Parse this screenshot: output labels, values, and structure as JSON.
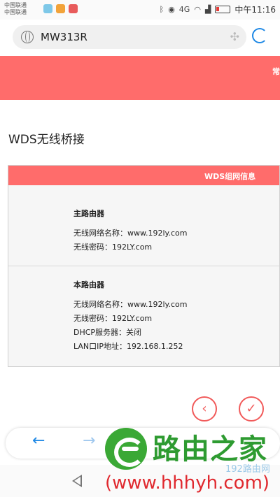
{
  "status_bar": {
    "carrier_1": "中国联通",
    "carrier_2": "中国联通",
    "network": "4G",
    "time": "中午11:16"
  },
  "address_bar": {
    "url": "MW313R"
  },
  "header": {
    "partial_text": "常"
  },
  "page": {
    "title": "WDS无线桥接"
  },
  "panel": {
    "title": "WDS组网信息",
    "main_router": {
      "heading": "主路由器",
      "ssid": "无线网络名称：www.192ly.com",
      "password": "无线密码：192LY.com"
    },
    "this_router": {
      "heading": "本路由器",
      "ssid": "无线网络名称：www.192ly.com",
      "password": "无线密码：192LY.com",
      "dhcp": "DHCP服务器：关闭",
      "lan_ip": "LAN口IP地址：192.168.1.252"
    }
  },
  "actions": {
    "prev_icon": "‹",
    "confirm_icon": "✓"
  },
  "toolbar": {
    "back_icon": "←",
    "forward_icon": "→"
  },
  "watermark": {
    "brand": "路由之家",
    "small": "192路由网",
    "url": "(www.hhhyh.com)"
  },
  "colors": {
    "accent_red": "#ff6c6b",
    "link_blue": "#1e88e5",
    "watermark_green": "#2e9b31"
  }
}
